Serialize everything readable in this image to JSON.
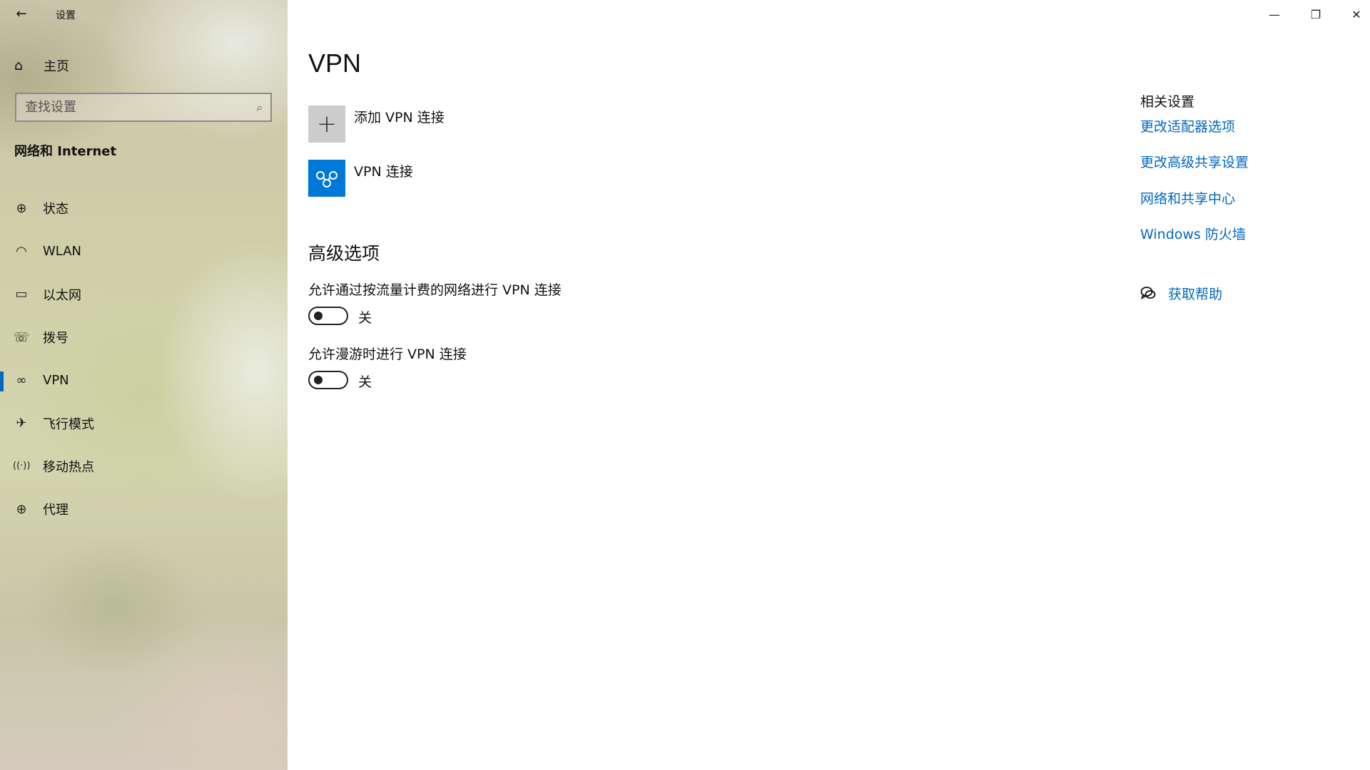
{
  "window": {
    "title": "设置",
    "back_icon": "←",
    "minimize_icon": "—",
    "restore_icon": "❐",
    "close_icon": "✕"
  },
  "sidebar": {
    "home": {
      "icon": "⌂",
      "label": "主页"
    },
    "search": {
      "placeholder": "查找设置",
      "icon": "⌕"
    },
    "section_title": "网络和 Internet",
    "items": [
      {
        "label": "状态",
        "icon": "globe-status-icon",
        "glyph": "⊕",
        "active": false
      },
      {
        "label": "WLAN",
        "icon": "wifi-icon",
        "glyph": "◠",
        "active": false
      },
      {
        "label": "以太网",
        "icon": "ethernet-icon",
        "glyph": "▭",
        "active": false
      },
      {
        "label": "拨号",
        "icon": "dialup-icon",
        "glyph": "☏",
        "active": false
      },
      {
        "label": "VPN",
        "icon": "vpn-icon",
        "glyph": "∞",
        "active": true
      },
      {
        "label": "飞行模式",
        "icon": "airplane-icon",
        "glyph": "✈",
        "active": false
      },
      {
        "label": "移动热点",
        "icon": "hotspot-icon",
        "glyph": "((·))",
        "active": false
      },
      {
        "label": "代理",
        "icon": "proxy-globe-icon",
        "glyph": "⊕",
        "active": false
      }
    ]
  },
  "main": {
    "title": "VPN",
    "add_vpn": {
      "label": "添加 VPN 连接",
      "icon": "+"
    },
    "vpn_connection": {
      "label": "VPN 连接"
    },
    "advanced": {
      "title": "高级选项",
      "options": [
        {
          "label": "允许通过按流量计费的网络进行 VPN 连接",
          "state": "关",
          "on": false
        },
        {
          "label": "允许漫游时进行 VPN 连接",
          "state": "关",
          "on": false
        }
      ]
    }
  },
  "related": {
    "title": "相关设置",
    "links": [
      "更改适配器选项",
      "更改高级共享设置",
      "网络和共享中心",
      "Windows 防火墙"
    ],
    "help": "获取帮助"
  },
  "colors": {
    "accent": "#0067c0",
    "vpn_tile": "#0078d7"
  }
}
